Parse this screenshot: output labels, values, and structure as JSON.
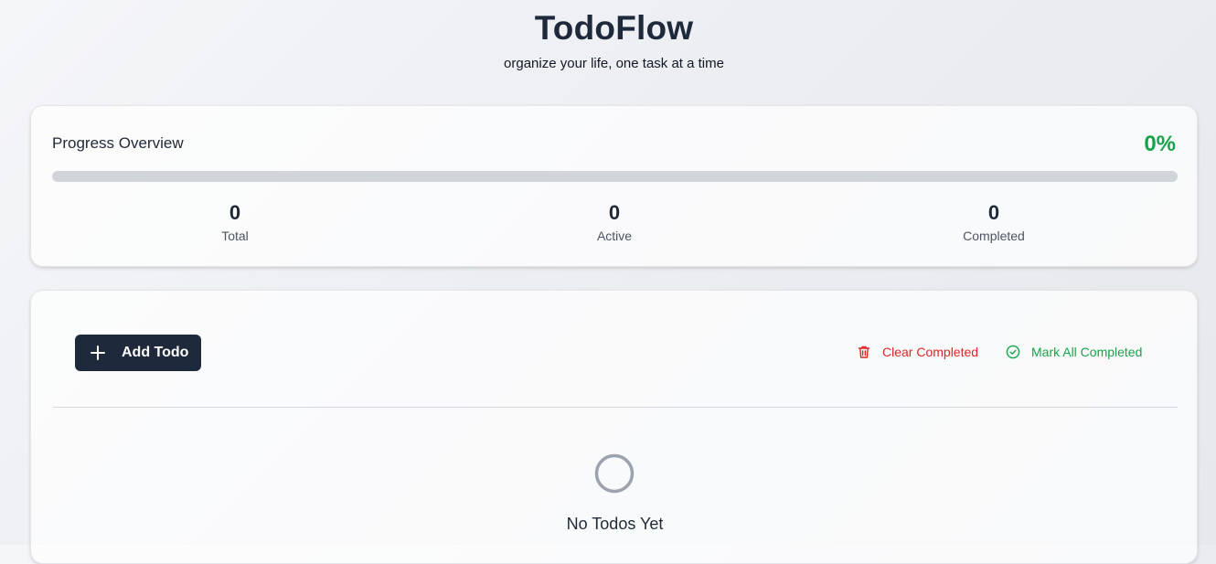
{
  "header": {
    "title": "TodoFlow",
    "subtitle": "organize your life, one task at a time"
  },
  "progress": {
    "title": "Progress Overview",
    "percent_label": "0%",
    "percent_value": 0,
    "accent_color": "#16a34a",
    "stats": {
      "total": {
        "value": "0",
        "label": "Total"
      },
      "active": {
        "value": "0",
        "label": "Active"
      },
      "completed": {
        "value": "0",
        "label": "Completed"
      }
    }
  },
  "toolbar": {
    "add_label": "Add Todo",
    "add_icon": "plus-icon",
    "clear_label": "Clear Completed",
    "clear_icon": "trash-icon",
    "clear_color": "#dc2626",
    "mark_label": "Mark All Completed",
    "mark_icon": "check-circle-icon",
    "mark_color": "#16a34a"
  },
  "empty_state": {
    "icon": "circle-icon",
    "title": "No Todos Yet"
  }
}
